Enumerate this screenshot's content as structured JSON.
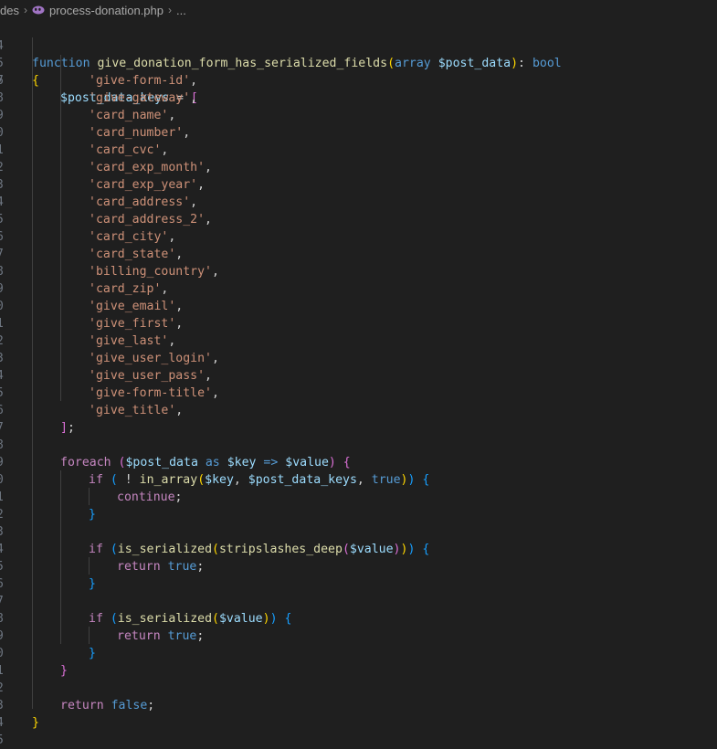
{
  "breadcrumb": {
    "folder": "des",
    "file": "process-donation.php",
    "more": "..."
  },
  "colors": {
    "background": "#1f1f1f",
    "line_number": "#6e7681",
    "keyword": "#569cd6",
    "control": "#c586c0",
    "function": "#dcdcaa",
    "variable": "#9cdcfe",
    "string": "#ce9178"
  },
  "lines": [
    {
      "n": "4"
    },
    {
      "n": "5"
    },
    {
      "n": "6"
    },
    {
      "n": "7"
    },
    {
      "n": "8"
    },
    {
      "n": "9"
    },
    {
      "n": "0"
    },
    {
      "n": "1"
    },
    {
      "n": "2"
    },
    {
      "n": "3"
    },
    {
      "n": "4"
    },
    {
      "n": "5"
    },
    {
      "n": "6"
    },
    {
      "n": "7"
    },
    {
      "n": "8"
    },
    {
      "n": "9"
    },
    {
      "n": "0"
    },
    {
      "n": "1"
    },
    {
      "n": "2"
    },
    {
      "n": "3"
    },
    {
      "n": "4"
    },
    {
      "n": "5"
    },
    {
      "n": "6"
    },
    {
      "n": "7"
    },
    {
      "n": "8"
    },
    {
      "n": "9"
    },
    {
      "n": "0"
    },
    {
      "n": "1"
    },
    {
      "n": "2"
    },
    {
      "n": "3"
    },
    {
      "n": "4"
    },
    {
      "n": "5"
    },
    {
      "n": "6"
    },
    {
      "n": "7"
    },
    {
      "n": "8"
    },
    {
      "n": "9"
    },
    {
      "n": "0"
    },
    {
      "n": "1"
    },
    {
      "n": "2"
    },
    {
      "n": "3"
    },
    {
      "n": "4"
    },
    {
      "n": "5"
    }
  ],
  "code": {
    "fn_keyword": "function",
    "fn_name": "give_donation_form_has_serialized_fields",
    "param_type": "array",
    "param_name": "$post_data",
    "return_type": "bool",
    "keys_var": "$post_data_keys",
    "keys": [
      "'give-form-id'",
      "'give-gateway'",
      "'card_name'",
      "'card_number'",
      "'card_cvc'",
      "'card_exp_month'",
      "'card_exp_year'",
      "'card_address'",
      "'card_address_2'",
      "'card_city'",
      "'card_state'",
      "'billing_country'",
      "'card_zip'",
      "'give_email'",
      "'give_first'",
      "'give_last'",
      "'give_user_login'",
      "'give_user_pass'",
      "'give-form-title'",
      "'give_title'"
    ],
    "foreach_kw": "foreach",
    "as_kw": "as",
    "key_var": "$key",
    "value_var": "$value",
    "if_kw": "if",
    "in_array_fn": "in_array",
    "true_kw": "true",
    "false_kw": "false",
    "continue_kw": "continue",
    "return_kw": "return",
    "is_serialized_fn": "is_serialized",
    "stripslashes_fn": "stripslashes_deep"
  }
}
